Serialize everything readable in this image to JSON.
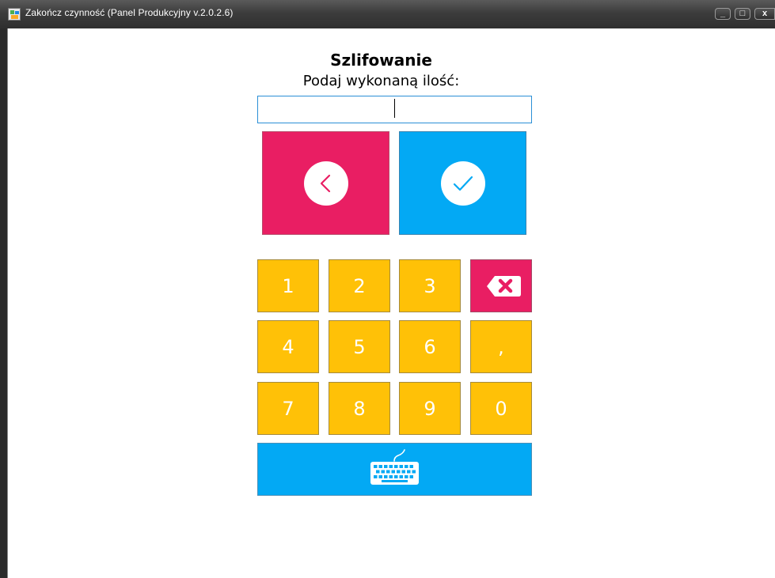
{
  "window": {
    "title": "Zakończ czynność (Panel Produkcyjny v.2.0.2.6)",
    "controls": {
      "minimize": "_",
      "maximize": "□",
      "close": "x"
    }
  },
  "form": {
    "heading": "Szlifowanie",
    "prompt": "Podaj wykonaną ilość:",
    "quantity_value": ""
  },
  "actions": {
    "back_icon": "chevron-left-icon",
    "confirm_icon": "check-icon"
  },
  "keypad": {
    "keys": [
      "1",
      "2",
      "3",
      "4",
      "5",
      "6",
      ",",
      "7",
      "8",
      "9",
      "0"
    ],
    "backspace_icon": "backspace-icon",
    "keyboard_icon": "keyboard-icon"
  },
  "colors": {
    "back": "#e91e63",
    "confirm": "#03a9f4",
    "key": "#ffc107",
    "backspace": "#e91e63",
    "keyboard": "#03a9f4"
  }
}
